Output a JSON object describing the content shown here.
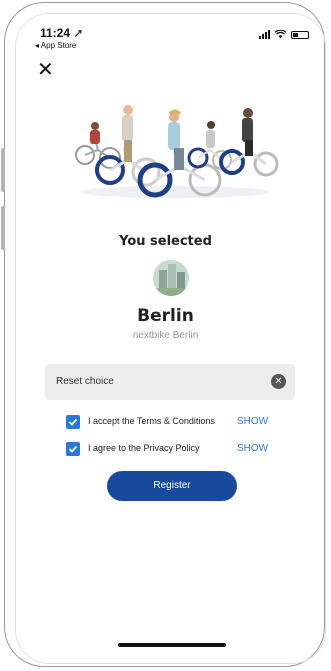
{
  "status_bar": {
    "time": "11:24",
    "back_app": "◂ App Store"
  },
  "header": {
    "close_icon": "close-icon"
  },
  "selection": {
    "title": "You selected",
    "city": "Berlin",
    "provider": "nextbike Berlin"
  },
  "reset": {
    "label": "Reset choice"
  },
  "consents": [
    {
      "label": "I accept the Terms & Conditions",
      "checked": true,
      "link": "SHOW"
    },
    {
      "label": "I agree to the Privacy Policy",
      "checked": true,
      "link": "SHOW"
    }
  ],
  "actions": {
    "register_label": "Register"
  },
  "colors": {
    "primary": "#174a9c",
    "link": "#2a78d8",
    "field_bg": "#ededed"
  }
}
